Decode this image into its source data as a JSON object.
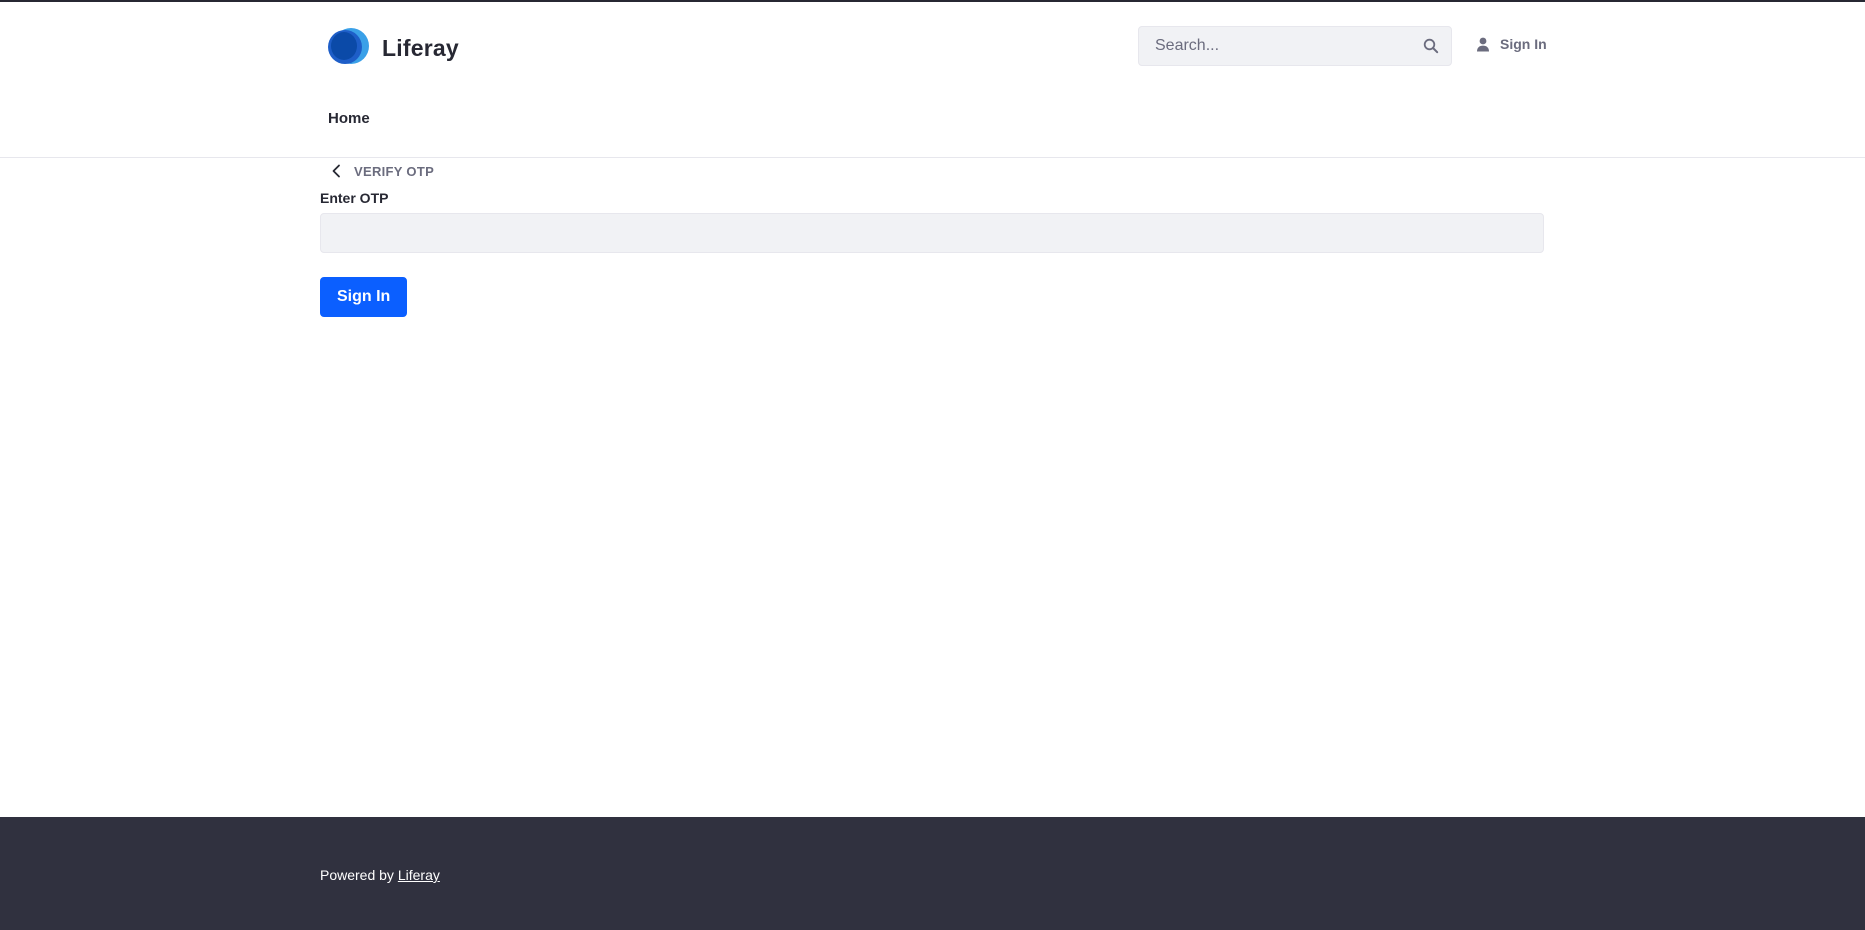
{
  "header": {
    "brand_name": "Liferay",
    "search": {
      "placeholder": "Search...",
      "value": ""
    },
    "sign_in_label": "Sign In",
    "nav": [
      {
        "label": "Home"
      }
    ]
  },
  "main": {
    "portlet_title": "VERIFY OTP",
    "otp_label": "Enter OTP",
    "otp_value": "",
    "submit_label": "Sign In"
  },
  "footer": {
    "powered_by": "Powered by",
    "link_label": "Liferay"
  },
  "colors": {
    "primary": "#0b5fff",
    "footer_bg": "#30313f",
    "input_bg": "#f1f2f5",
    "muted_text": "#6b6c7e"
  },
  "icons": [
    "liferay-logo-icon",
    "search-icon",
    "user-icon",
    "chevron-left-icon"
  ]
}
